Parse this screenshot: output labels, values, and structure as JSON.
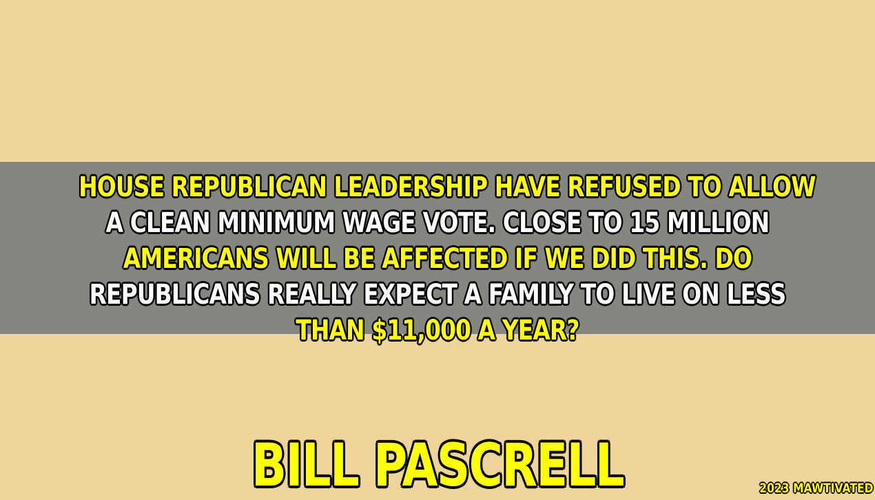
{
  "quote": {
    "lines": [
      {
        "text": "HOUSE REPUBLICAN LEADERSHIP HAVE REFUSED TO ALLOW",
        "color": "#ffff00"
      },
      {
        "text": "A CLEAN MINIMUM WAGE VOTE. CLOSE TO 15 MILLION",
        "color": "#ffffff"
      },
      {
        "text": "AMERICANS WILL BE AFFECTED IF WE DID THIS. DO",
        "color": "#ffff00"
      },
      {
        "text": "REPUBLICANS REALLY EXPECT A FAMILY TO LIVE ON LESS",
        "color": "#ffffff"
      },
      {
        "text": "THAN $11,000 A YEAR?",
        "color": "#ffff00"
      }
    ]
  },
  "author": "BILL PASCRELL",
  "credit": "2023 MAWTIVATED",
  "colors": {
    "background": "#f1d39c",
    "band": "#868680",
    "accent_yellow": "#ffff00",
    "text_white": "#ffffff",
    "outline": "#000000"
  }
}
